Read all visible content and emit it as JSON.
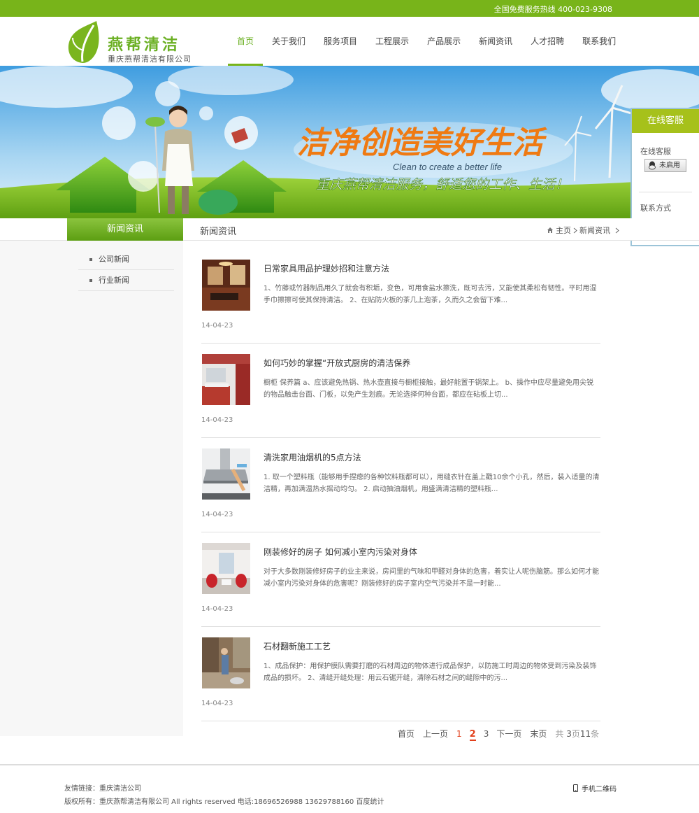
{
  "topbar": {
    "hotline": "全国免费服务热线 400-023-9308"
  },
  "logo": {
    "name": "燕帮清洁",
    "subtitle": "重庆燕帮清洁有限公司"
  },
  "nav": [
    "首页",
    "关于我们",
    "服务项目",
    "工程展示",
    "产品展示",
    "新闻资讯",
    "人才招聘",
    "联系我们"
  ],
  "banner": {
    "slogan": "洁净创造美好生活",
    "slogan_en": "Clean to create a better life",
    "tagline": "重庆燕帮清洁服务，舒适您的工作、生活！"
  },
  "service": {
    "title": "在线客服",
    "online_label": "在线客服",
    "qq_status": "未启用",
    "contact_label": "联系方式",
    "phone": "400-023-9308"
  },
  "category": {
    "title": "新闻资讯"
  },
  "page": {
    "title": "新闻资讯"
  },
  "breadcrumb": {
    "home": "主页",
    "current": "新闻资讯"
  },
  "sidebar": [
    "公司新闻",
    "行业新闻"
  ],
  "news": [
    {
      "title": "日常家具用品护理妙招和注意方法",
      "summary": "1、竹藤或竹器制品用久了就会有积垢，变色，可用食盐水擦洗，既可去污，又能使其柔松有韧性。平时用湿手巾擦擦可使其保持清洁。 2、在贴防火板的茶几上泡茶，久而久之会留下难...",
      "date": "14-04-23"
    },
    {
      "title": "如何巧妙的掌握“开放式厨房的清洁保养",
      "summary": "橱柜 保养篇 a、应该避免热锅、热水壶直接与橱柜接触，最好能置于锅架上。 b、操作中应尽量避免用尖锐的物品触击台面、门板，以免产生划痕。无论选择何种台面，都应在砧板上切...",
      "date": "14-04-23"
    },
    {
      "title": "清洗家用油烟机的5点方法",
      "summary": "1. 取一个塑料瓶（能够用手捏瘪的各种饮料瓶都可以），用缝衣针在盖上戳10余个小孔，然后，装入适量的清洁精，再加满温热水摇动均匀。 2. 启动抽油烟机，用盛满清洁精的塑料瓶...",
      "date": "14-04-23"
    },
    {
      "title": "刚装修好的房子 如何减小室内污染对身体",
      "summary": "对于大多数刚装修好房子的业主来说，房间里的气味和甲醛对身体的危害，着实让人呢伤脑筋。那么如何才能减小室内污染对身体的危害呢？刚装修好的房子室内空气污染并不是一时能...",
      "date": "14-04-23"
    },
    {
      "title": "石材翻新施工工艺",
      "summary": "1、成品保护：用保护膜队需要打磨的石材周边的物体进行成品保护，以防施工时周边的物体受到污染及装饰成品的损坏。 2、清缝开缝处理：用云石锯开缝，清除石材之间的缝隙中的污...",
      "date": "14-04-23"
    }
  ],
  "pager": {
    "first": "首页",
    "prev": "上一页",
    "pages": [
      "1",
      "2",
      "3"
    ],
    "current": "2",
    "next": "下一页",
    "last": "末页",
    "total_pre": "共",
    "total_pages": "3",
    "total_mid": "页",
    "total_items": "11",
    "total_post": "条"
  },
  "footer": {
    "links": "友情链接：重庆清洁公司",
    "copyright": "版权所有：重庆燕帮清洁有限公司 All rights reserved 电话:18696526988 13629788160 百度统计",
    "qr": "手机二维码"
  },
  "colors": {
    "brand_green": "#78b41a",
    "accent_orange": "#e2401c",
    "service_green": "#a6c11b"
  }
}
